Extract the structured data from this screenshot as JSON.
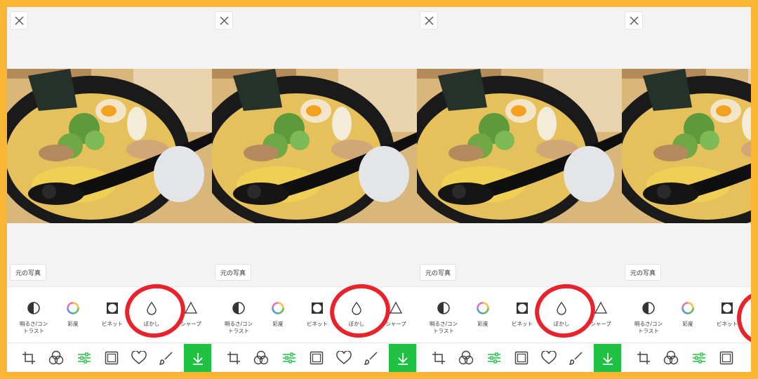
{
  "close_icon": "close-icon",
  "original_button_label": "元の写真",
  "tools": [
    {
      "label": "明るさ/コン\nトラスト",
      "icon": "brightness-contrast-icon"
    },
    {
      "label": "彩度",
      "icon": "saturation-icon"
    },
    {
      "label": "ビネット",
      "icon": "vignette-icon"
    },
    {
      "label": "ぼかし",
      "icon": "blur-icon"
    },
    {
      "label": "シャープ",
      "icon": "sharpen-icon"
    }
  ],
  "bottom_bar_icons": [
    "crop-icon",
    "filter-icon",
    "adjust-icon",
    "frame-icon",
    "sticker-heart-icon",
    "brush-icon",
    "download-icon"
  ],
  "highlight_color": "#e8232c",
  "accent_color": "#1fc143",
  "background_color": "#fbb535"
}
